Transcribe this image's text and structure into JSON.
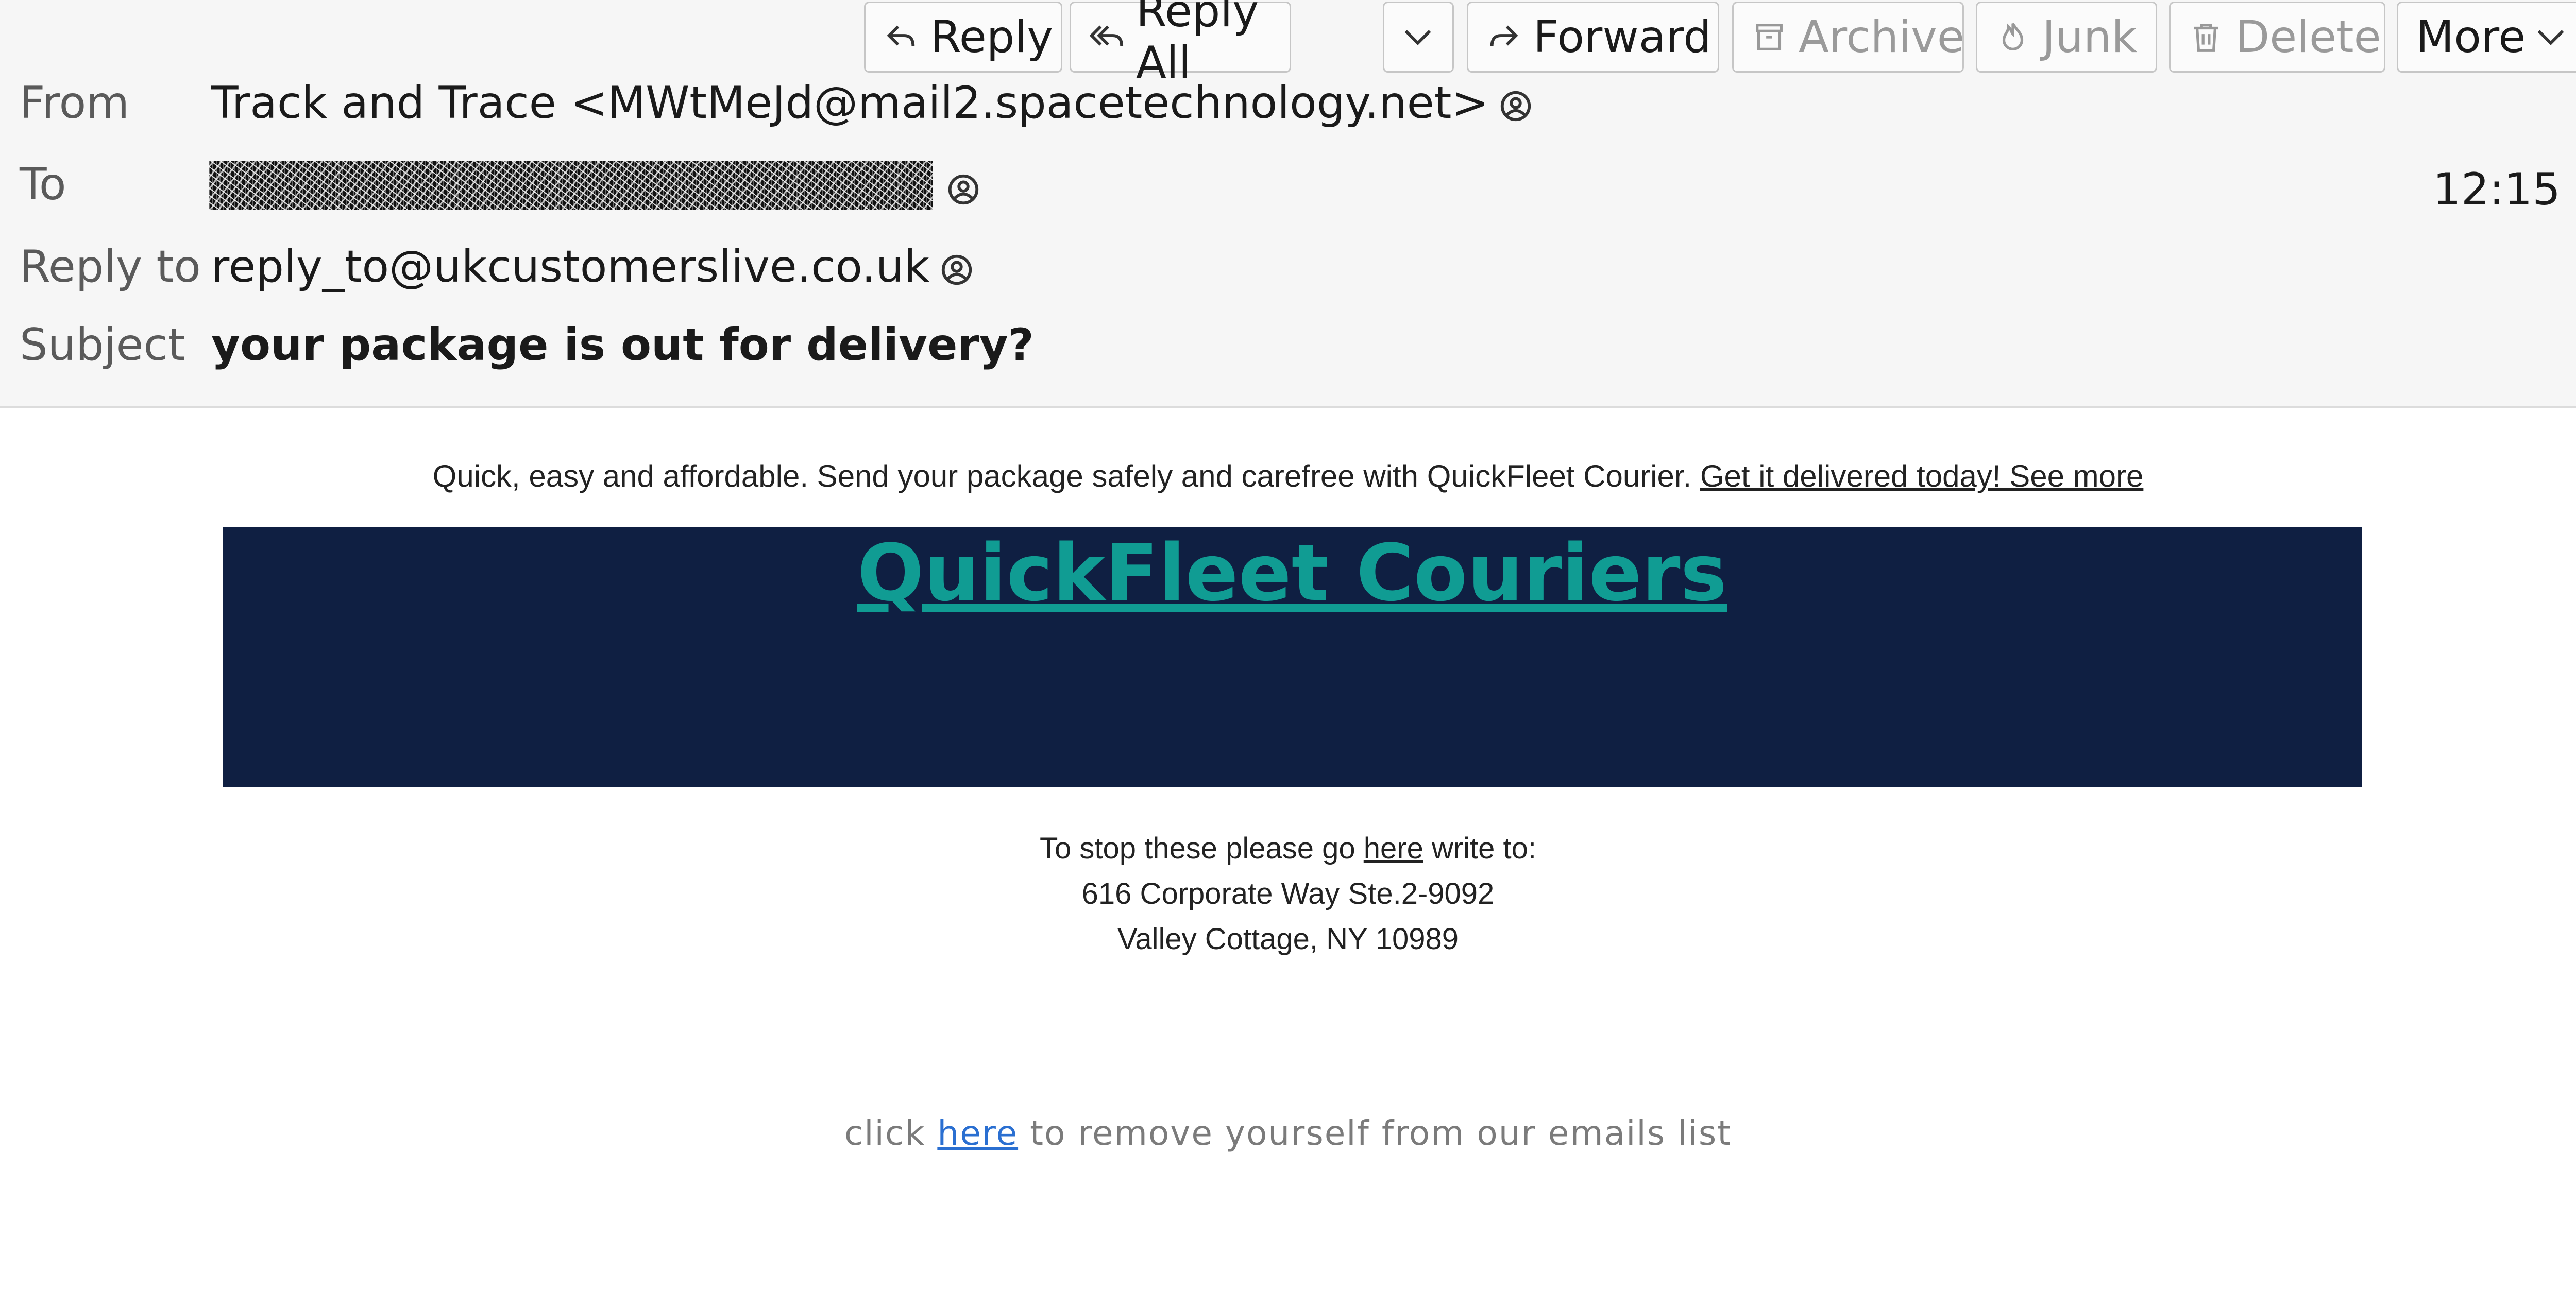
{
  "toolbar": {
    "reply": "Reply",
    "reply_all": "Reply All",
    "forward": "Forward",
    "archive": "Archive",
    "junk": "Junk",
    "delete": "Delete",
    "more": "More"
  },
  "header": {
    "from_label": "From",
    "from_value": "Track and Trace <MWtMeJd@mail2.spacetechnology.net>",
    "to_label": "To",
    "time": "12:15",
    "reply_to_label": "Reply to",
    "reply_to_value": "reply_to@ukcustomerslive.co.uk",
    "subject_label": "Subject",
    "subject_value": "your package is out for delivery?"
  },
  "email": {
    "teaser_text": "Quick, easy and affordable. Send your package safely and carefree with QuickFleet Courier. ",
    "teaser_link": "Get it delivered today! See more",
    "brand": "QuickFleet Couriers",
    "stop_pre": "To stop these please go ",
    "stop_link": "here",
    "stop_post": " write to:",
    "address_line1": "616 Corporate Way Ste.2-9092",
    "address_line2": "Valley Cottage, NY 10989",
    "unsub_pre": "click ",
    "unsub_link": "here",
    "unsub_post": " to remove yourself from our emails list"
  },
  "colors": {
    "banner_bg": "#0f1f42",
    "brand_color": "#109c93",
    "link_blue": "#2a6fd1"
  }
}
